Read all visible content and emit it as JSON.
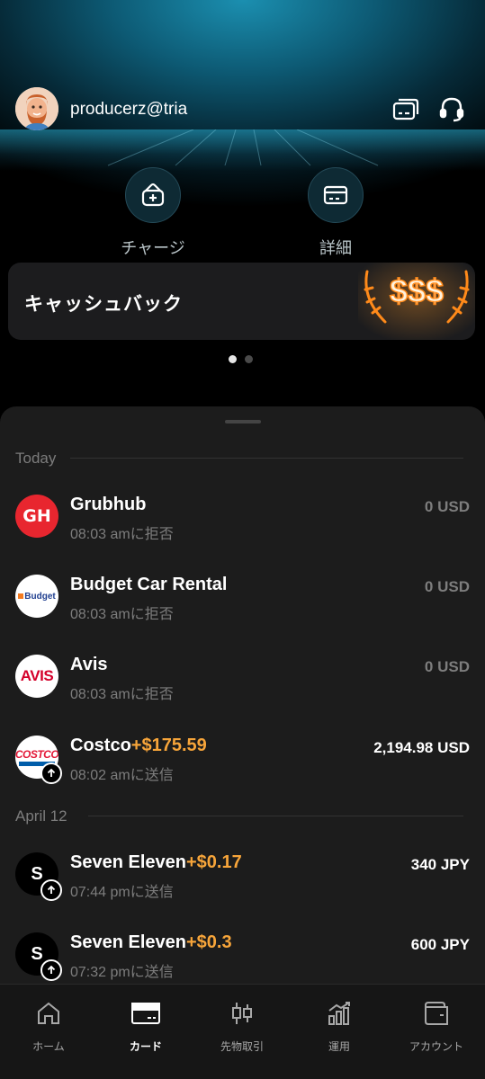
{
  "header": {
    "username": "producerz@tria",
    "icons": [
      "cards-icon",
      "headset-icon"
    ]
  },
  "actions": [
    {
      "label": "チャージ",
      "icon": "wallet-plus-icon"
    },
    {
      "label": "詳細",
      "icon": "card-details-icon"
    }
  ],
  "banner": {
    "text": "キャッシュバック",
    "deco_text": "$$$"
  },
  "pager": {
    "count": 2,
    "active": 0
  },
  "transactions": {
    "sections": [
      {
        "heading": "Today",
        "items": [
          {
            "name": "Grubhub",
            "cashback": "",
            "sub": "08:03 amに拒否",
            "amount": "0 USD",
            "logo": "grubhub-logo",
            "logo_text": "GH"
          },
          {
            "name": "Budget Car Rental",
            "cashback": "",
            "sub": "08:03 amに拒否",
            "amount": "0 USD",
            "logo": "budget-logo",
            "logo_text": "Budget"
          },
          {
            "name": "Avis",
            "cashback": "",
            "sub": "08:03 amに拒否",
            "amount": "0 USD",
            "logo": "avis-logo",
            "logo_text": "AVIS"
          },
          {
            "name": "Costco",
            "cashback": "+$175.59",
            "sub": "08:02 amに送信",
            "amount": "2,194.98 USD",
            "logo": "costco-logo",
            "logo_text": "COSTCO"
          }
        ]
      },
      {
        "heading": "April 12",
        "items": [
          {
            "name": "Seven Eleven",
            "cashback": "+$0.17",
            "sub": "07:44 pmに送信",
            "amount": "340 JPY",
            "logo": "letter-avatar",
            "logo_text": "S"
          },
          {
            "name": "Seven Eleven",
            "cashback": "+$0.3",
            "sub": "07:32 pmに送信",
            "amount": "600 JPY",
            "logo": "letter-avatar",
            "logo_text": "S"
          }
        ]
      }
    ]
  },
  "nav": {
    "items": [
      {
        "label": "ホーム",
        "icon": "home-icon"
      },
      {
        "label": "カード",
        "icon": "card-icon"
      },
      {
        "label": "先物取引",
        "icon": "candlestick-icon"
      },
      {
        "label": "運用",
        "icon": "bar-chart-icon"
      },
      {
        "label": "アカウント",
        "icon": "wallet-icon"
      }
    ],
    "active": 1
  },
  "colors": {
    "accent_cashback": "#f7a53a",
    "hero_teal": "#1b8fb0",
    "sheet_bg": "#1c1c1c",
    "muted_text": "#7d7d7d"
  }
}
